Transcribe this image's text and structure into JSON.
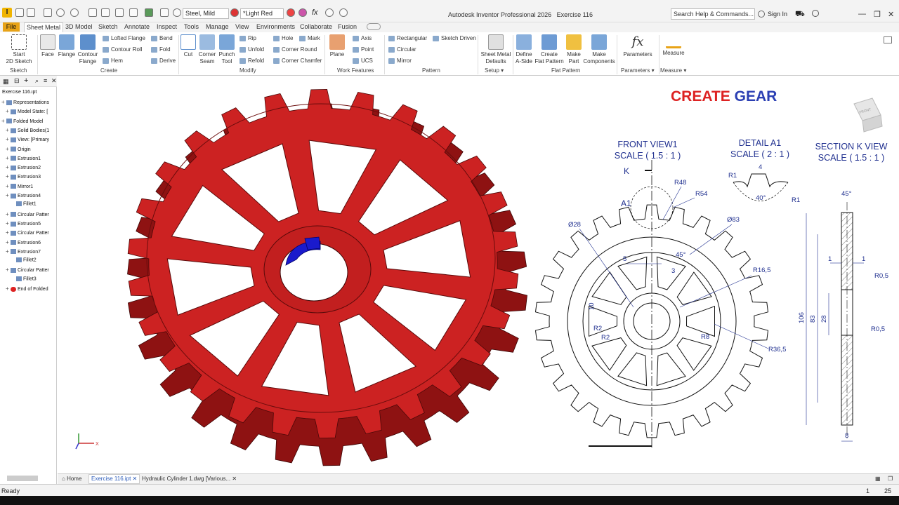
{
  "app": {
    "title": "Autodesk Inventor Professional 2026",
    "document": "Exercise 116",
    "logo": "I"
  },
  "quick": {
    "material": "Steel, Mild",
    "appearance": "*Light Red",
    "fx": "fx"
  },
  "search": {
    "placeholder": "Search Help & Commands..."
  },
  "user": {
    "signin": "Sign In"
  },
  "tabs": [
    "File",
    "Sheet Metal",
    "3D Model",
    "Sketch",
    "Annotate",
    "Inspect",
    "Tools",
    "Manage",
    "View",
    "Environments",
    "Collaborate",
    "Fusion"
  ],
  "ribbon": {
    "start_sketch": "Start\n2D Sketch",
    "sketch_panel": "Sketch",
    "face": "Face",
    "flange": "Flange",
    "contour_flange": "Contour\nFlange",
    "lofted_flange": "Lofted Flange",
    "contour_roll": "Contour Roll",
    "hem": "Hem",
    "bend": "Bend",
    "fold": "Fold",
    "derive": "Derive",
    "create_panel": "Create",
    "cut": "Cut",
    "corner_seam": "Corner\nSeam",
    "punch_tool": "Punch\nTool",
    "rip": "Rip",
    "unfold": "Unfold",
    "refold": "Refold",
    "hole": "Hole",
    "corner_round": "Corner Round",
    "corner_chamfer": "Corner Chamfer",
    "mark": "Mark",
    "modify_panel": "Modify",
    "plane": "Plane",
    "axis": "Axis",
    "point": "Point",
    "ucs": "UCS",
    "work_panel": "Work Features",
    "rectangular": "Rectangular",
    "circular": "Circular",
    "mirror": "Mirror",
    "sketch_driven": "Sketch Driven",
    "pattern_panel": "Pattern",
    "sm_defaults": "Sheet Metal\nDefaults",
    "setup_panel": "Setup",
    "define_aside": "Define\nA-Side",
    "create_flat": "Create\nFlat Pattern",
    "make_part": "Make\nPart",
    "make_components": "Make\nComponents",
    "flat_panel": "Flat Pattern",
    "parameters": "Parameters",
    "parameters_panel": "Parameters",
    "measure": "Measure",
    "measure_panel": "Measure"
  },
  "browser": {
    "root": "Exercise 116.ipt",
    "nodes": [
      "Representations",
      "Model State: [",
      "Folded Model",
      "Solid Bodies(1",
      "View: [Primary",
      "Origin",
      "Extrusion1",
      "Extrusion2",
      "Extrusion3",
      "Mirror1",
      "Extrusion4",
      "Fillet1",
      "Circular Patter",
      "Extrusion5",
      "Circular Patter",
      "Extrusion6",
      "Extrusion7",
      "Fillet2",
      "Circular Patter",
      "Fillet3",
      "End of Folded"
    ]
  },
  "drawing": {
    "heading_red": "CREATE",
    "heading_blue": "GEAR",
    "front_view": "FRONT VIEW1",
    "front_scale": "SCALE  ( 1.5 : 1 )",
    "detail": "DETAIL A1",
    "detail_scale": "SCALE  ( 2 : 1 )",
    "section": "SECTION K VIEW",
    "section_scale": "SCALE  ( 1.5 : 1 )",
    "k": "K",
    "a1": "A1",
    "dims": {
      "r48": "R48",
      "r54": "R54",
      "d28": "Ø28",
      "d83": "Ø83",
      "five": "5",
      "three": "3",
      "a45": "45°",
      "r165": "R16,5",
      "ten": "10",
      "r2a": "R2",
      "r2b": "R2",
      "r8": "R8",
      "r365": "R36,5",
      "r1a": "R1",
      "r1b": "R1",
      "four": "4",
      "a40": "40°",
      "s45": "45°",
      "s1a": "1",
      "s1b": "1",
      "r05a": "R0,5",
      "r05b": "R0,5",
      "s106": "106",
      "s83": "83",
      "s28": "28",
      "s8": "8"
    },
    "viewcube": "FRONT"
  },
  "docs": {
    "home": "Home",
    "active": "Exercise 116.ipt",
    "other": "Hydraulic Cylinder 1.dwg [Various..."
  },
  "status": {
    "text": "Ready",
    "n1": "1",
    "n2": "25"
  },
  "colors": {
    "gear": "#cc2222",
    "keyway": "#1a1acc",
    "heading_red": "#dd2222",
    "heading_blue": "#2b3fb3",
    "dim_blue": "#1f2f8f",
    "file_tab": "#e8a317"
  }
}
